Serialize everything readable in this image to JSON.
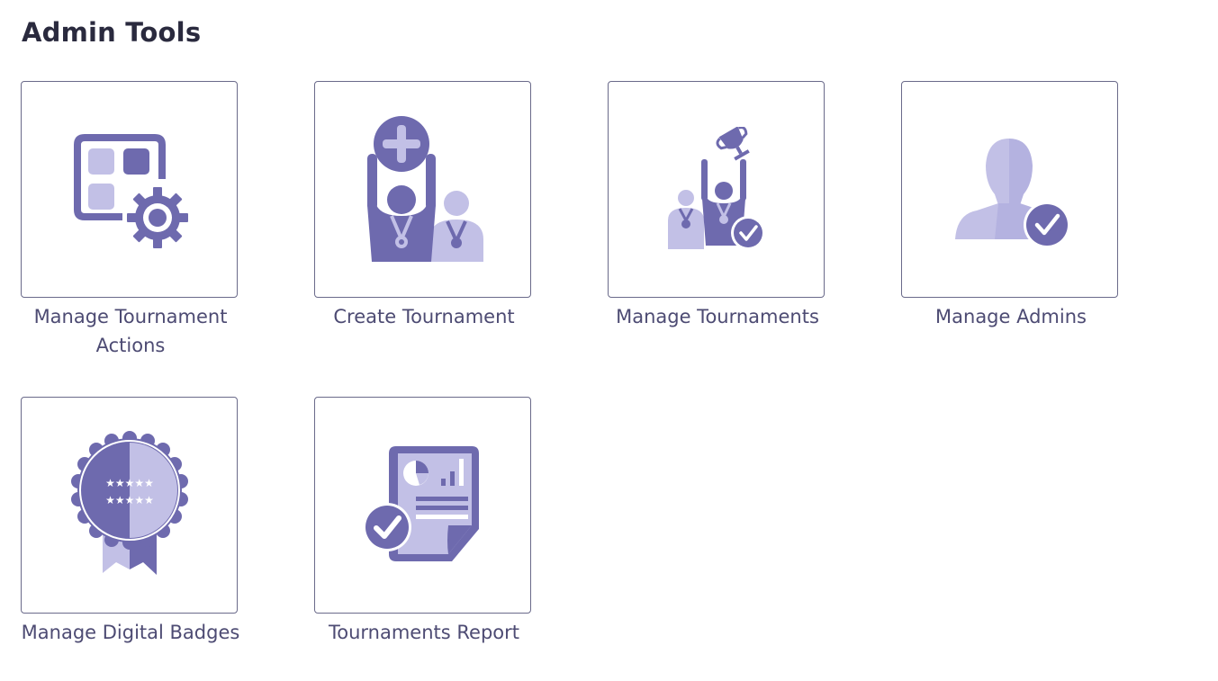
{
  "page": {
    "title": "Admin Tools"
  },
  "colors": {
    "accent_dark": "#6e6aae",
    "accent_light": "#c2c0e6",
    "text": "#4d4b73",
    "heading": "#2a2a3e"
  },
  "tools": [
    {
      "label": "Manage Tournament Actions",
      "icon": "grid-gear-icon"
    },
    {
      "label": "Create Tournament",
      "icon": "people-plus-icon"
    },
    {
      "label": "Manage Tournaments",
      "icon": "trophy-winner-check-icon"
    },
    {
      "label": "Manage Admins",
      "icon": "user-check-icon"
    },
    {
      "label": "Manage Digital Badges",
      "icon": "badge-ribbon-icon"
    },
    {
      "label": "Tournaments Report",
      "icon": "report-check-icon"
    }
  ]
}
